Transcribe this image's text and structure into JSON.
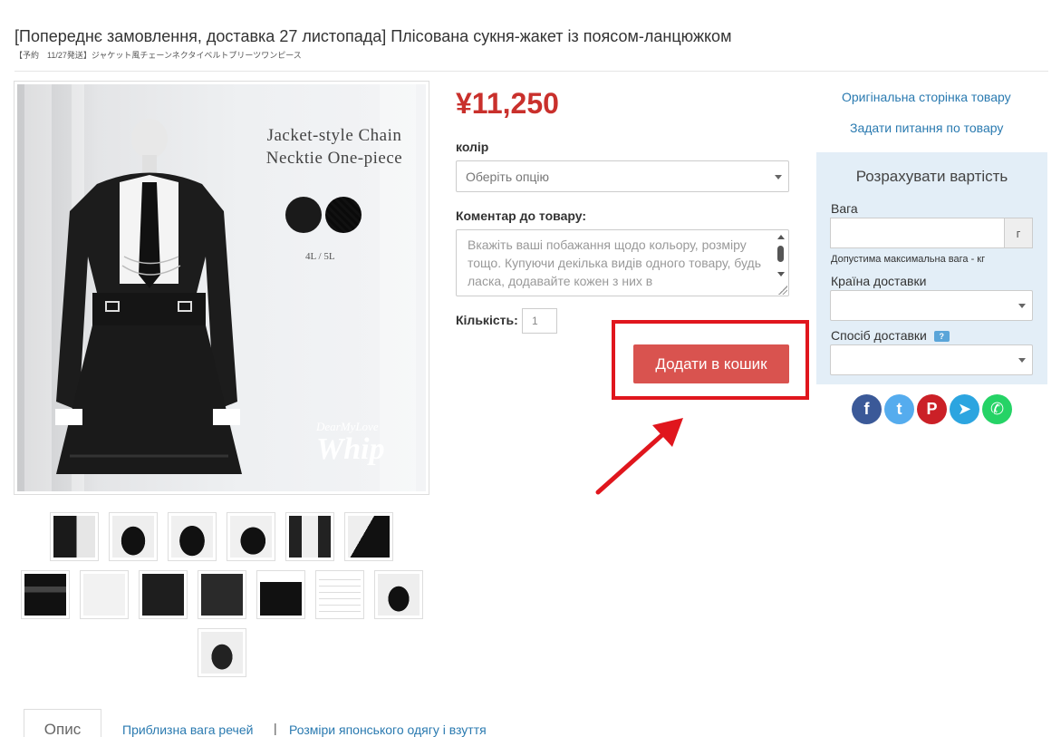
{
  "product": {
    "title": "[Попереднє замовлення, доставка 27 листопада] Плісована сукня-жакет із поясом-ланцюжком",
    "subtitle": "【予約　11/27発送】ジャケット風チェーンネクタイベルトプリーツワンピース",
    "image_headline_line1": "Jacket-style Chain",
    "image_headline_line2": "Necktie One-piece",
    "image_sizes": "4L / 5L",
    "image_brand_small": "DearMyLove",
    "image_brand_big": "Whip",
    "price": "¥11,250"
  },
  "options": {
    "color_label": "колір",
    "color_placeholder": "Оберіть опцію",
    "comment_label": "Коментар до товару:",
    "comment_placeholder": "Вкажіть ваші побажання щодо кольору, розміру тощо. Купуючи декілька видів одного товару, будь ласка, додавайте кожен з них в",
    "quantity_label": "Кількість:",
    "quantity_value": "1",
    "add_to_cart": "Додати в кошик"
  },
  "links": {
    "original_page": "Оригінальна сторінка товару",
    "ask_question": "Задати питання по товару"
  },
  "calculator": {
    "title": "Розрахувати вартість",
    "weight_label": "Вага",
    "weight_unit": "г",
    "weight_hint": "Допустима максимальна вага - кг",
    "country_label": "Країна доставки",
    "method_label": "Спосіб доставки",
    "help_badge": "?"
  },
  "social": [
    {
      "name": "facebook-icon",
      "glyph": "f",
      "color": "#3b5998"
    },
    {
      "name": "twitter-icon",
      "glyph": "t",
      "color": "#55acee"
    },
    {
      "name": "pinterest-icon",
      "glyph": "P",
      "color": "#cb2027"
    },
    {
      "name": "telegram-icon",
      "glyph": "➤",
      "color": "#2ca5e0"
    },
    {
      "name": "whatsapp-icon",
      "glyph": "✆",
      "color": "#25d366"
    }
  ],
  "tabs": {
    "description": "Опис",
    "weight_link": "Приблизна вага речей",
    "separator": "|",
    "sizes_link": "Розміри японського одягу і взуття"
  },
  "colors": {
    "price": "#c9302c",
    "button": "#d9534f",
    "highlight": "#e0161d",
    "link": "#2a7ab0",
    "panel": "#e3eef7"
  }
}
